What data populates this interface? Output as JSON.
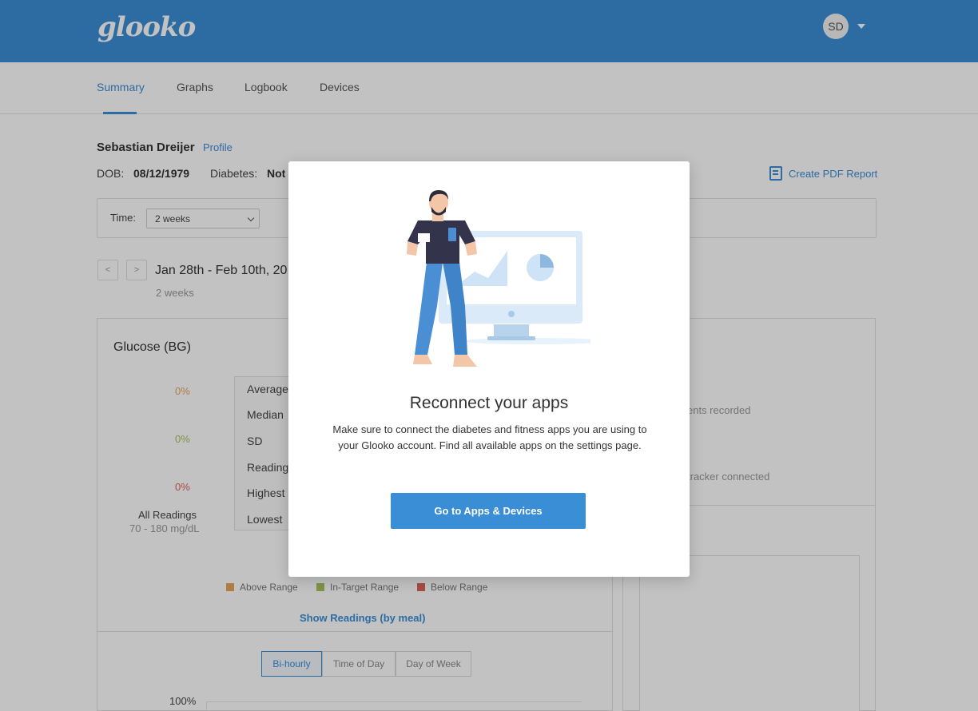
{
  "app": {
    "logo_text": "glooko",
    "brand_color": "#3a8ed6"
  },
  "header": {
    "avatar_initials": "SD"
  },
  "tabs": [
    {
      "label": "Summary",
      "active": true
    },
    {
      "label": "Graphs",
      "active": false
    },
    {
      "label": "Logbook",
      "active": false
    },
    {
      "label": "Devices",
      "active": false
    }
  ],
  "patient": {
    "name": "Sebastian Dreijer",
    "profile_link": "Profile",
    "dob_label": "DOB:",
    "dob": "08/12/1979",
    "diabetes_label": "Diabetes:",
    "diabetes_value": "Not"
  },
  "report": {
    "create_pdf_label": "Create PDF Report"
  },
  "filters": {
    "time_label": "Time:",
    "time_value": "2 weeks"
  },
  "date_nav": {
    "prev": "<",
    "next": ">",
    "range": "Jan 28th - Feb 10th, 20",
    "period": "2 weeks"
  },
  "glucose": {
    "title": "Glucose (BG)",
    "percentages": [
      "0%",
      "0%",
      "0%"
    ],
    "percent_colors": [
      "#e8a45a",
      "#a9c25d",
      "#d9645b"
    ],
    "all_readings_label": "All Readings",
    "target_range": "70 - 180 mg/dL",
    "stats": [
      "Average",
      "Median",
      "SD",
      "Readings",
      "Highest",
      "Lowest"
    ],
    "legend": [
      {
        "label": "Above Range",
        "color": "#e8a45a"
      },
      {
        "label": "In-Target Range",
        "color": "#a9c25d"
      },
      {
        "label": "Below Range",
        "color": "#d9645b"
      }
    ],
    "show_readings_label": "Show Readings (by meal)",
    "segments": [
      "Bi-hourly",
      "Time of Day",
      "Day of Week"
    ],
    "active_segment": "Bi-hourly",
    "y_axis_top": "100%"
  },
  "right_panel": {
    "text1": "ents recorded",
    "text2": "tracker connected"
  },
  "modal": {
    "title": "Reconnect your apps",
    "body": "Make sure to connect the diabetes and fitness apps you are using to your Glooko account. Find all available apps on the settings page.",
    "button_label": "Go to Apps & Devices"
  }
}
